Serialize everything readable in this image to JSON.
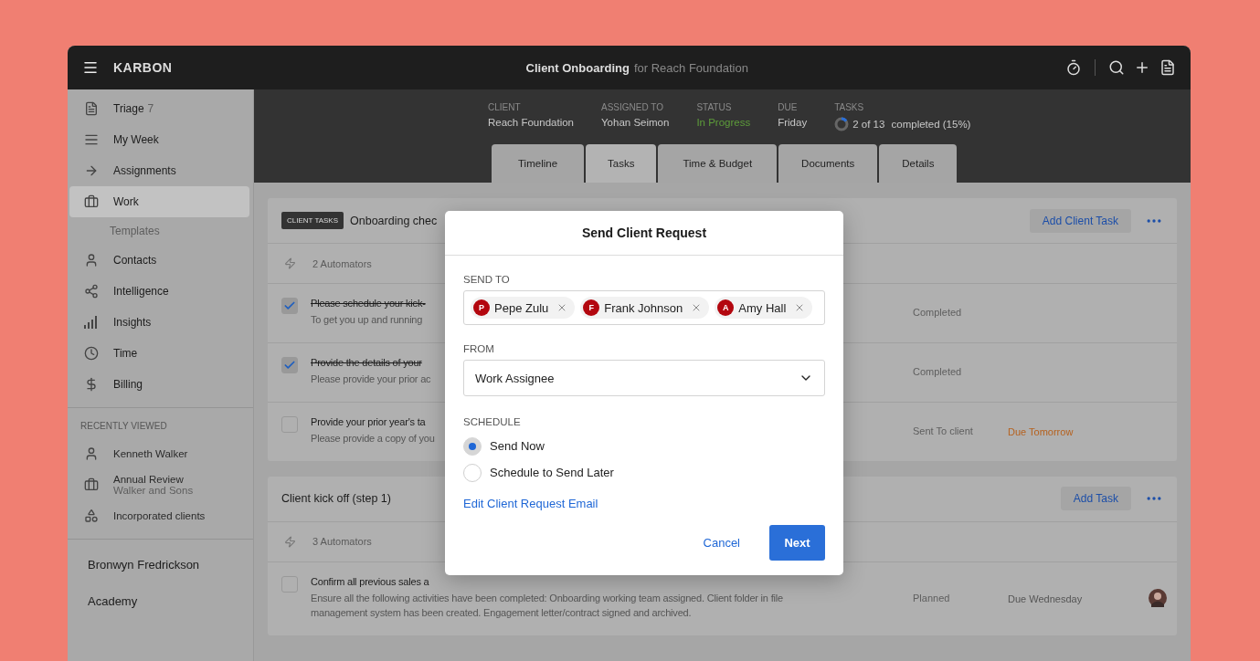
{
  "topbar": {
    "brand": "KARBON",
    "title": "Client Onboarding",
    "subtitle": "for Reach Foundation"
  },
  "sidebar": {
    "items": [
      {
        "label": "Triage",
        "count": "7",
        "selected": false
      },
      {
        "label": "My Week",
        "selected": false
      },
      {
        "label": "Assignments",
        "selected": false
      },
      {
        "label": "Work",
        "selected": true,
        "children": [
          {
            "label": "Templates",
            "selected": false
          }
        ]
      },
      {
        "label": "Contacts",
        "selected": false
      },
      {
        "label": "Intelligence",
        "selected": false
      },
      {
        "label": "Insights",
        "selected": false
      },
      {
        "label": "Time",
        "selected": false
      },
      {
        "label": "Billing",
        "selected": false
      }
    ],
    "recently_viewed": {
      "heading": "RECENTLY VIEWED",
      "items": [
        {
          "title": "Kenneth Walker"
        },
        {
          "title": "Annual Review",
          "subtitle": "Walker and Sons"
        },
        {
          "title": "Incorporated clients"
        }
      ]
    },
    "footer_links": [
      "Bronwyn Fredrickson",
      "Academy"
    ]
  },
  "header": {
    "meta": [
      {
        "kind": "text",
        "label": "CLIENT",
        "value": "Reach Foundation"
      },
      {
        "kind": "text",
        "label": "ASSIGNED TO",
        "value": "Yohan Seimon"
      },
      {
        "kind": "status",
        "label": "STATUS",
        "value": "In Progress"
      },
      {
        "kind": "text",
        "label": "DUE",
        "value": "Friday"
      },
      {
        "kind": "progress",
        "label": "TASKS",
        "value": "2 of 13",
        "suffix": "completed (15%)",
        "level": 0.15
      }
    ],
    "tabs": [
      {
        "label": "Timeline",
        "selected": false
      },
      {
        "label": "Tasks",
        "selected": true
      },
      {
        "label": "Time & Budget",
        "selected": false
      },
      {
        "label": "Documents",
        "selected": false
      },
      {
        "label": "Details",
        "selected": false
      }
    ]
  },
  "sections": [
    {
      "tag": "CLIENT TASKS",
      "title": "Onboarding chec",
      "button": "Add Client Task",
      "automators": "2 Automators",
      "tasks": [
        {
          "checked": true,
          "title": "Please schedule your kick-",
          "description": "To get you up and running",
          "status": "Completed"
        },
        {
          "checked": true,
          "title": "Provide the details of your",
          "description": "Please provide your prior ac",
          "status": "Completed"
        },
        {
          "checked": false,
          "title": "Provide your prior year's ta",
          "description": "Please provide a copy of you",
          "status": "Sent To client",
          "due": "Due Tomorrow",
          "urgent": true
        }
      ]
    },
    {
      "title": "Client kick off (step 1)",
      "button": "Add Task",
      "automators": "3 Automators",
      "tasks": [
        {
          "checked": false,
          "title": "Confirm all previous sales a",
          "description": "Ensure all the following activities have been completed: Onboarding working team assigned. Client folder in file management system has been created. Engagement letter/contract signed and archived.",
          "status": "Planned",
          "due": "Due Wednesday",
          "urgent": false,
          "avatar": true
        }
      ]
    }
  ],
  "modal": {
    "title": "Send Client Request",
    "send_to": {
      "label": "SEND TO",
      "recipients": [
        {
          "initial": "P",
          "name": "Pepe Zulu"
        },
        {
          "initial": "F",
          "name": "Frank Johnson"
        },
        {
          "initial": "A",
          "name": "Amy Hall"
        }
      ]
    },
    "from": {
      "label": "FROM",
      "value": "Work Assignee"
    },
    "schedule": {
      "label": "SCHEDULE",
      "options": [
        {
          "label": "Send Now",
          "selected": true
        },
        {
          "label": "Schedule to Send Later",
          "selected": false
        }
      ]
    },
    "link": "Edit Client Request Email",
    "cancel": "Cancel",
    "next": "Next"
  }
}
